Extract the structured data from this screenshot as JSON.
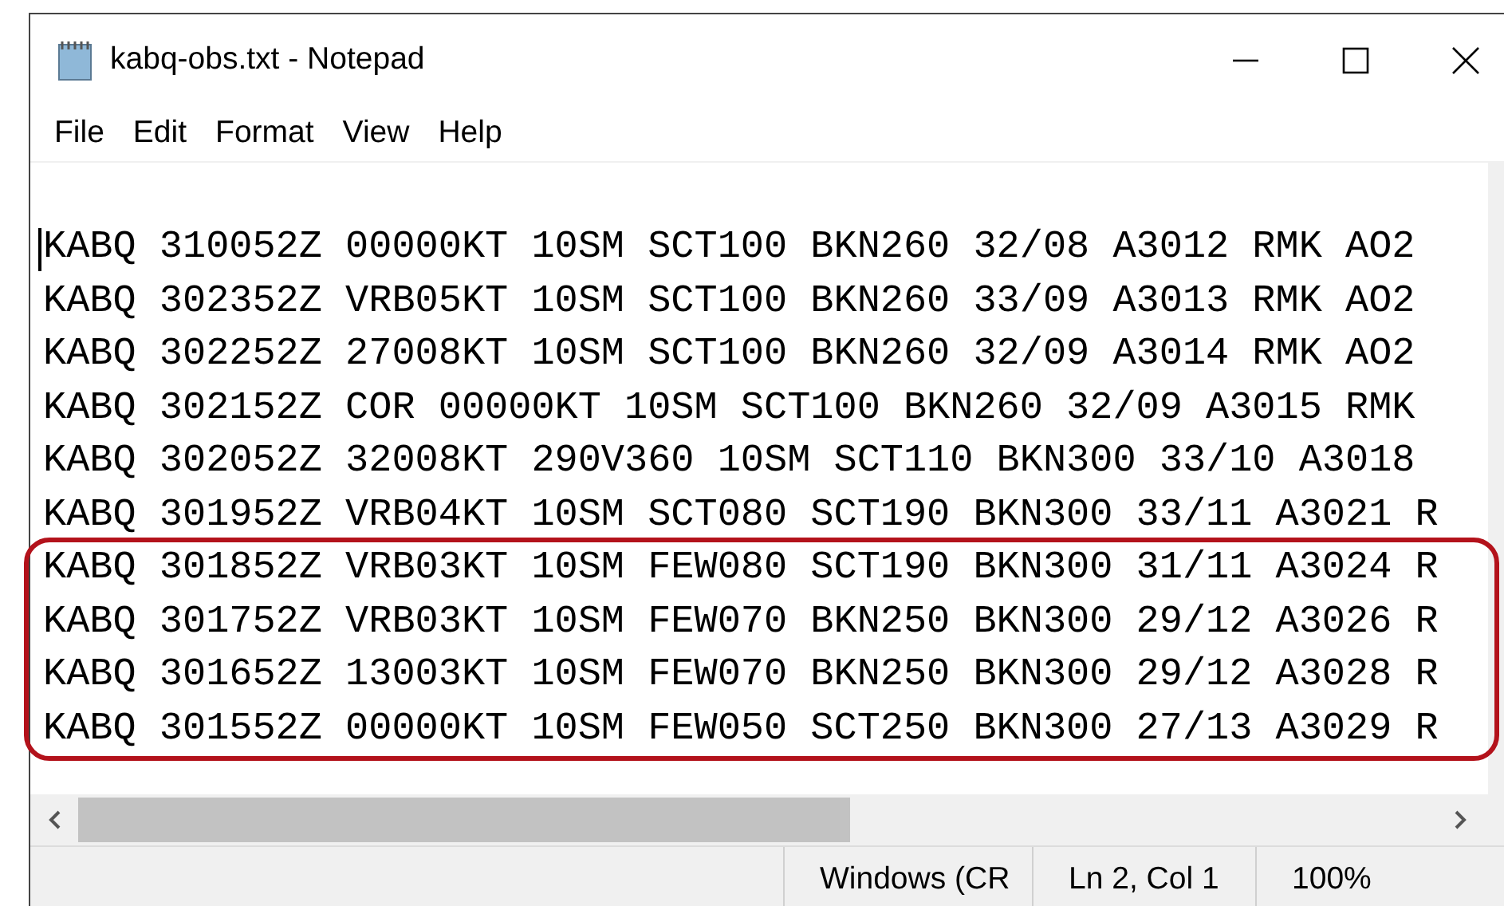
{
  "window": {
    "title": "kabq-obs.txt - Notepad"
  },
  "menu": [
    "File",
    "Edit",
    "Format",
    "View",
    "Help"
  ],
  "lines": [
    {
      "text": "KABQ 310052Z 00000KT 10SM SCT100 BKN260 32/08 A3012 RMK AO2",
      "highlighted": false
    },
    {
      "text": "KABQ 302352Z VRB05KT 10SM SCT100 BKN260 33/09 A3013 RMK AO2",
      "highlighted": false
    },
    {
      "text": "KABQ 302252Z 27008KT 10SM SCT100 BKN260 32/09 A3014 RMK AO2",
      "highlighted": false
    },
    {
      "text": "KABQ 302152Z COR 00000KT 10SM SCT100 BKN260 32/09 A3015 RMK",
      "highlighted": false
    },
    {
      "text": "KABQ 302052Z 32008KT 290V360 10SM SCT110 BKN300 33/10 A3018",
      "highlighted": false
    },
    {
      "text": "KABQ 301952Z VRB04KT 10SM SCT080 SCT190 BKN300 33/11 A3021 R",
      "highlighted": false
    },
    {
      "text": "KABQ 301852Z VRB03KT 10SM FEW080 SCT190 BKN300 31/11 A3024 R",
      "highlighted": true
    },
    {
      "text": "KABQ 301752Z VRB03KT 10SM FEW070 BKN250 BKN300 29/12 A3026 R",
      "highlighted": true
    },
    {
      "text": "KABQ 301652Z 13003KT 10SM FEW070 BKN250 BKN300 29/12 A3028 R",
      "highlighted": true
    },
    {
      "text": "KABQ 301552Z 00000KT 10SM FEW050 SCT250 BKN300 27/13 A3029 R",
      "highlighted": true
    }
  ],
  "status_bar": {
    "line_ending": "Windows (CR",
    "position": "Ln 2, Col 1",
    "zoom": "100%"
  }
}
